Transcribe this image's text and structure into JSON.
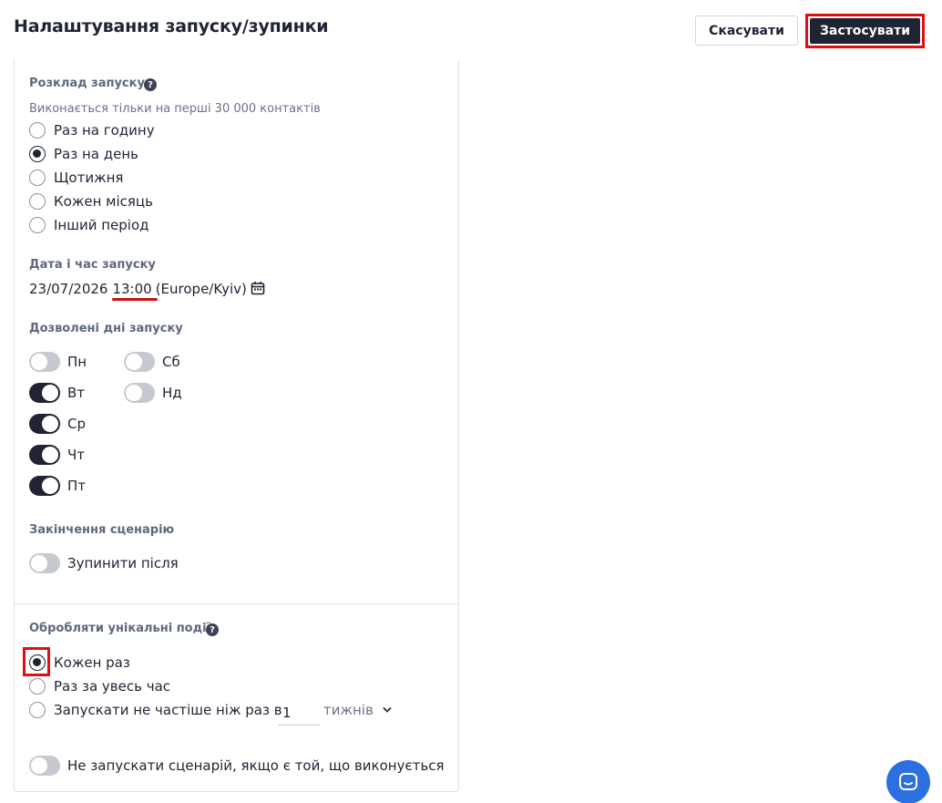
{
  "header": {
    "title": "Налаштування запуску/зупинки",
    "cancel_label": "Скасувати",
    "apply_label": "Застосувати"
  },
  "schedule": {
    "label": "Розклад запуску",
    "hint": "Виконається тільки на перші 30 000 контактів",
    "options": [
      {
        "label": "Раз на годину",
        "checked": false
      },
      {
        "label": "Раз на день",
        "checked": true
      },
      {
        "label": "Щотижня",
        "checked": false
      },
      {
        "label": "Кожен місяць",
        "checked": false
      },
      {
        "label": "Інший період",
        "checked": false
      }
    ]
  },
  "datetime": {
    "label": "Дата і час запуску",
    "date": "23/07/2026",
    "time": "13:00",
    "timezone": "(Europe/Kyiv)"
  },
  "days": {
    "label": "Дозволені дні запуску",
    "items": [
      {
        "label": "Пн",
        "on": false
      },
      {
        "label": "Вт",
        "on": true
      },
      {
        "label": "Ср",
        "on": true
      },
      {
        "label": "Чт",
        "on": true
      },
      {
        "label": "Пт",
        "on": true
      },
      {
        "label": "Сб",
        "on": false
      },
      {
        "label": "Нд",
        "on": false
      }
    ]
  },
  "ending": {
    "label": "Закінчення сценарію",
    "stop_after_label": "Зупинити після",
    "stop_after_on": false
  },
  "unique_events": {
    "label": "Обробляти унікальні події:",
    "options": [
      {
        "label": "Кожен раз",
        "checked": true
      },
      {
        "label": "Раз за увесь час",
        "checked": false
      },
      {
        "label": "Запускати не частіше ніж раз в",
        "checked": false
      }
    ],
    "interval_value": "1",
    "interval_unit": "тижнів"
  },
  "no_parallel": {
    "label": "Не запускати сценарій, якщо є той, що виконується",
    "on": false
  },
  "colors": {
    "primary": "#1f2433",
    "highlight": "#e01010",
    "chat": "#2b6fe0"
  }
}
